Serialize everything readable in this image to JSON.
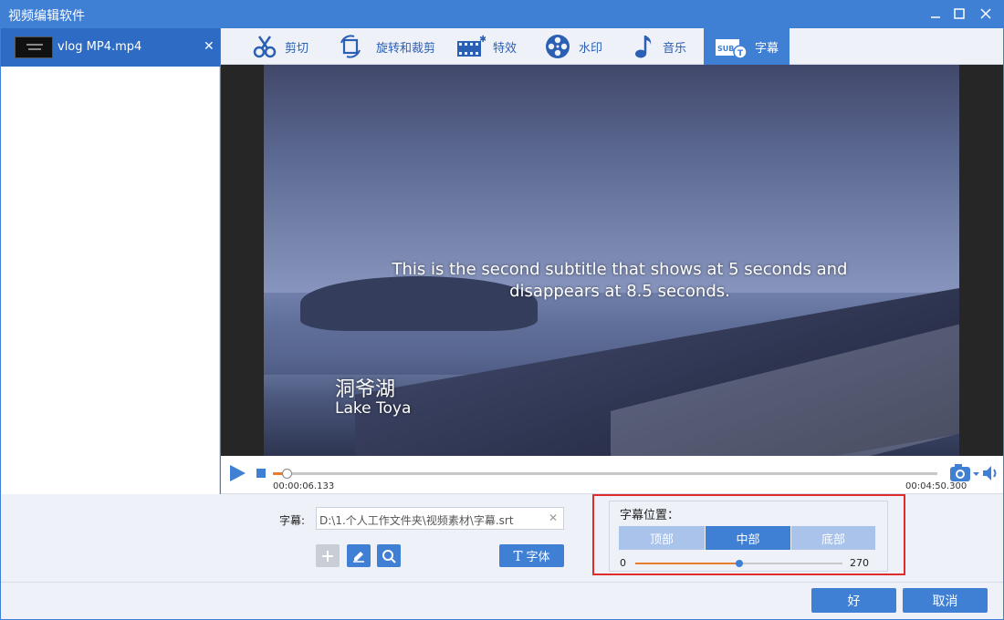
{
  "window": {
    "title": "视频编辑软件",
    "minimize_icon": "minimize-icon",
    "maximize_icon": "maximize-icon",
    "close_icon": "close-icon"
  },
  "sidebar": {
    "files": [
      {
        "name": "vlog MP4.mp4",
        "selected": true,
        "close_label": "✕"
      }
    ]
  },
  "tabs": [
    {
      "label": "剪切",
      "icon": "scissors-icon",
      "active": false
    },
    {
      "label": "旋转和裁剪",
      "icon": "rotate-crop-icon",
      "active": false
    },
    {
      "label": "特效",
      "icon": "effects-film-icon",
      "active": false
    },
    {
      "label": "水印",
      "icon": "watermark-reel-icon",
      "active": false
    },
    {
      "label": "音乐",
      "icon": "music-note-icon",
      "active": false
    },
    {
      "label": "字幕",
      "icon": "subtitle-icon",
      "active": true
    }
  ],
  "preview": {
    "subtitle_text": "This is the second subtitle that shows at 5 seconds and disappears at 8.5 seconds.",
    "watermark_cn": "洞爷湖",
    "watermark_en": "Lake Toya"
  },
  "player": {
    "current_time": "00:00:06.133",
    "total_time": "00:04:50.300",
    "progress_fraction": 0.0211,
    "play_icon": "play-icon",
    "stop_icon": "stop-icon",
    "camera_icon": "camera-icon",
    "volume_icon": "volume-icon"
  },
  "subtitle_panel": {
    "label": "字幕:",
    "file_path": "D:\\1.个人工作文件夹\\视频素材\\字幕.srt",
    "clear_label": "✕",
    "add_icon": "plus-icon",
    "edit_icon": "pencil-icon",
    "search_icon": "search-icon",
    "font_button": "字体",
    "font_icon": "T"
  },
  "position_panel": {
    "title": "字幕位置：",
    "options": [
      "顶部",
      "中部",
      "底部"
    ],
    "selected": "中部",
    "slider_min": "0",
    "slider_max": "270",
    "slider_value": 135
  },
  "footer": {
    "ok_label": "好",
    "cancel_label": "取消"
  },
  "colors": {
    "accent": "#3f7fd4",
    "progress": "#e87d2c",
    "highlight_border": "#e02b2b"
  }
}
